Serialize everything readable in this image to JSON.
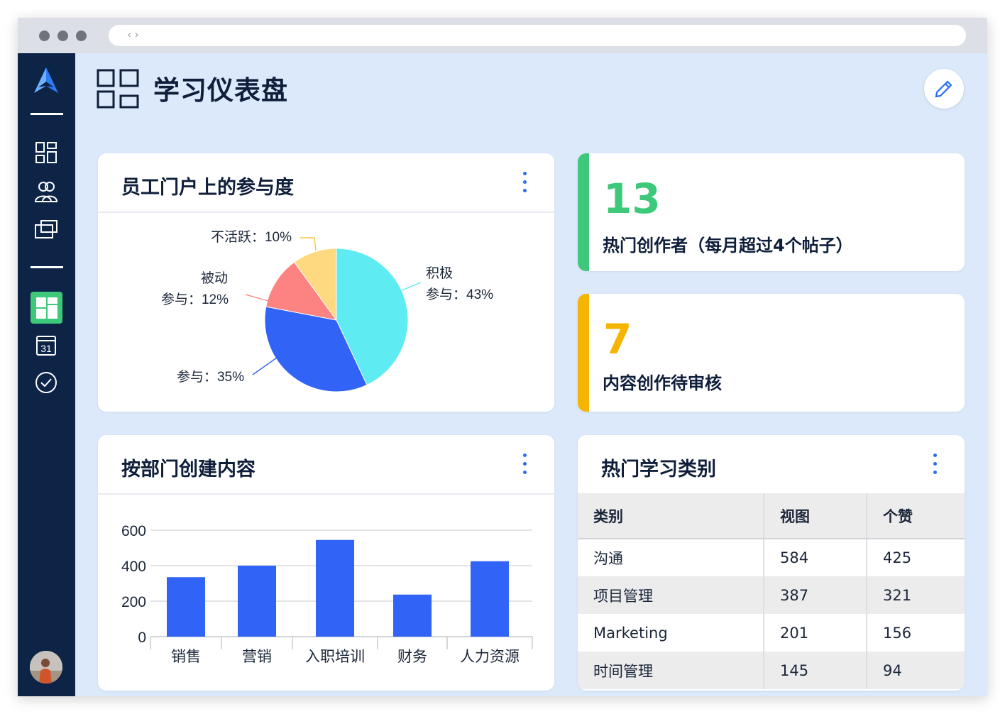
{
  "page": {
    "title": "学习仪表盘"
  },
  "engagement": {
    "title": "员工门户上的参与度",
    "labels": [
      {
        "lines": [
          "不活跃：10%"
        ]
      },
      {
        "lines": [
          "被动",
          "参与：12%"
        ]
      },
      {
        "lines": [
          "参与：35%"
        ]
      },
      {
        "lines": [
          "积极",
          "参与：43%"
        ]
      }
    ]
  },
  "stats": [
    {
      "value": "13",
      "label": "热门创作者（每月超过4个帖子）",
      "color": "#3ec97a"
    },
    {
      "value": "7",
      "label": "内容创作待审核",
      "color": "#f5b400"
    }
  ],
  "departments": {
    "title": "按部门创建内容"
  },
  "categories": {
    "title": "热门学习类别",
    "headers": [
      "类别",
      "视图",
      "个赞"
    ],
    "rows": [
      [
        "沟通",
        "584",
        "425"
      ],
      [
        "项目管理",
        "387",
        "321"
      ],
      [
        "Marketing",
        "201",
        "156"
      ],
      [
        "时间管理",
        "145",
        "94"
      ]
    ]
  },
  "chart_data": [
    {
      "type": "pie",
      "title": "员工门户上的参与度",
      "slices": [
        {
          "label": "积极参与",
          "value": 43,
          "color": "#5eecf2"
        },
        {
          "label": "参与",
          "value": 35,
          "color": "#3163f6"
        },
        {
          "label": "被动参与",
          "value": 12,
          "color": "#fd8383"
        },
        {
          "label": "不活跃",
          "value": 10,
          "color": "#ffd97f"
        }
      ]
    },
    {
      "type": "bar",
      "title": "按部门创建内容",
      "categories": [
        "销售",
        "营销",
        "入职培训",
        "财务",
        "人力资源"
      ],
      "values": [
        335,
        400,
        545,
        237,
        425
      ],
      "ylim": [
        0,
        600
      ],
      "yticks": [
        "0",
        "200",
        "400",
        "600"
      ],
      "grid": true,
      "color": "#3163f6"
    }
  ]
}
